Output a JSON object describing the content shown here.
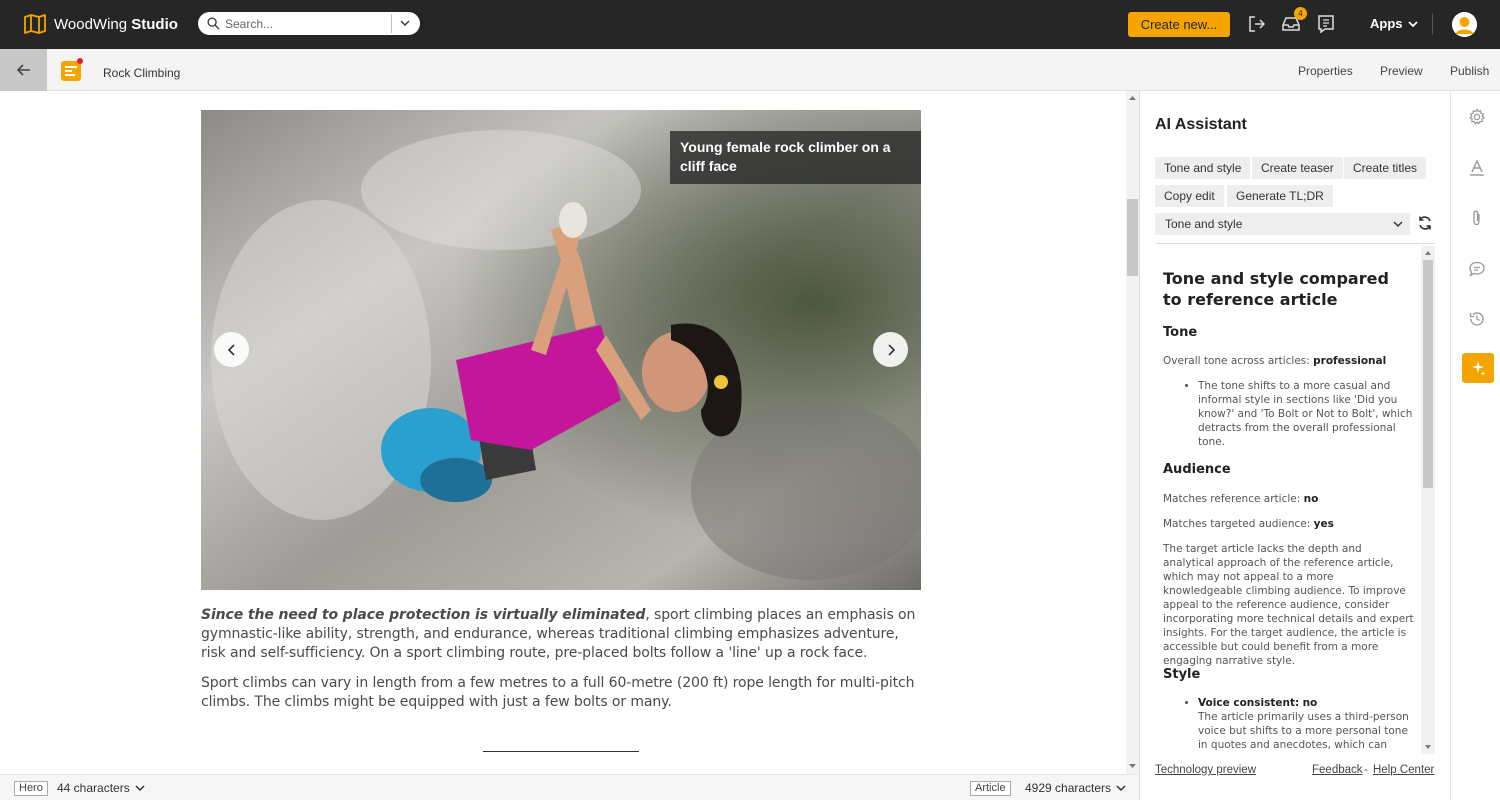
{
  "app": {
    "logo_name": "WoodWing",
    "logo_product": "Studio",
    "brand_color": "#f6a500"
  },
  "search": {
    "placeholder": "Search..."
  },
  "topbar": {
    "create_label": "Create new...",
    "inbox_badge": "4",
    "apps_label": "Apps"
  },
  "document": {
    "title": "Rock Climbing",
    "nav": [
      "Properties",
      "Preview",
      "Publish"
    ]
  },
  "article": {
    "image_caption": "Young female rock climber on a cliff face",
    "para1_emphasis": "Since the need to place protection is virtually eliminated",
    "para1_rest": ", sport climbing places an emphasis on gymnastic-like ability, strength, and endurance, whereas traditional climbing emphasizes adventure, risk and self-sufficiency. On a sport climbing route, pre-placed bolts follow a 'line' up a rock face.",
    "para2": "Sport climbs can vary in length from a few metres to a full 60-metre (200 ft) rope length for multi-pitch climbs. The climbs might be equipped with just a few bolts or many."
  },
  "footer": {
    "left_tag": "Hero",
    "left_count": "44 characters",
    "right_tag": "Article",
    "right_count": "4929 characters"
  },
  "assistant": {
    "title": "AI Assistant",
    "chips": [
      "Tone and style",
      "Create teaser",
      "Create titles",
      "Copy edit",
      "Generate TL;DR"
    ],
    "selected": "Tone and style",
    "result": {
      "heading": "Tone and style compared to reference article",
      "tone_heading": "Tone",
      "tone_label": "Overall tone across articles:",
      "tone_value": "professional",
      "tone_bullet": "The tone shifts to a more casual and informal style in sections like 'Did you know?' and 'To Bolt or Not to Bolt', which detracts from the overall professional tone.",
      "audience_heading": "Audience",
      "audience_ref_label": "Matches reference article:",
      "audience_ref_value": "no",
      "audience_target_label": "Matches targeted audience:",
      "audience_target_value": "yes",
      "audience_text": "The target article lacks the depth and analytical approach of the reference article, which may not appeal to a more knowledgeable climbing audience. To improve appeal to the reference audience, consider incorporating more technical details and expert insights. For the target audience, the article is accessible but could benefit from a more engaging narrative style.",
      "style_heading": "Style",
      "style_bullet_label": "Voice consistent:",
      "style_bullet_value": "no",
      "style_bullet_text": "The article primarily uses a third-person voice but shifts to a more personal tone in quotes and anecdotes, which can"
    },
    "footer_left": "Technology preview",
    "footer_feedback": "Feedback",
    "footer_sep": "-",
    "footer_help": "Help Center"
  },
  "rail": [
    "settings-icon",
    "text-style-icon",
    "attachment-icon",
    "comments-icon",
    "history-icon",
    "ai-sparkle-icon"
  ]
}
